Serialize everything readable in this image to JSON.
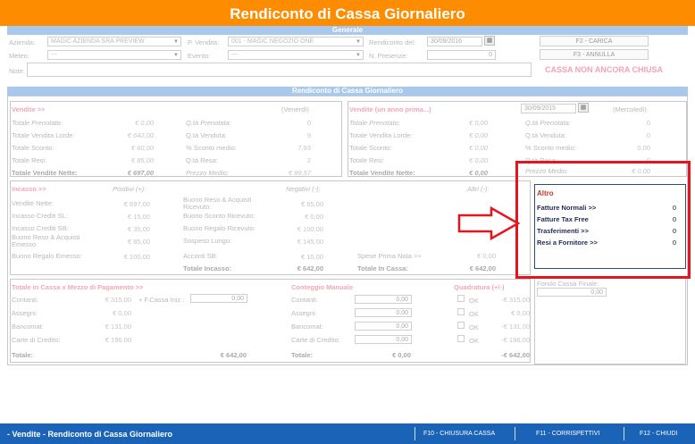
{
  "title": "Rendiconto di Cassa Giornaliero",
  "generale": {
    "header": "Generale",
    "azienda_label": "Azienda:",
    "azienda_value": "MAGIC AZIENDA SRA PREVIEW",
    "pvendita_label": "P. Vendita:",
    "pvendita_value": "001 - MAGIC NEGOZIO ONE",
    "rendiconto_label": "Rendiconto del:",
    "rendiconto_date": "30/09/2016",
    "f2_carica": "F2 - CARICA",
    "meteo_label": "Meteo:",
    "meteo_value": "---",
    "evento_label": "Evento:",
    "evento_value": "---",
    "npresenze_label": "N. Presenze:",
    "npresenze_value": "0",
    "f3_annulla": "F3 - ANNULLA",
    "note_label": "Note:",
    "status": "CASSA NON ANCORA CHIUSA"
  },
  "rendiconto": {
    "header": "Rendiconto di Cassa Giornaliero",
    "vendite": {
      "title": "Vendite >>",
      "day": "(Venerdì)",
      "rows": [
        {
          "label": "Totale Prenotato:",
          "value": "€ 0,00",
          "label2": "Q.tà Prenotata:",
          "value2": "0"
        },
        {
          "label": "Totale Vendita Lorde:",
          "value": "€ 642,00",
          "label2": "Q.tà Venduta:",
          "value2": "9"
        },
        {
          "label": "Totale Sconto:",
          "value": "€ 60,00",
          "label2": "% Sconto medio:",
          "value2": "7,93"
        },
        {
          "label": "Totale Resi:",
          "value": "€ 85,00",
          "label2": "Q.tà Resa:",
          "value2": "2"
        },
        {
          "label": "Totale Vendite Nette:",
          "value": "€ 697,00",
          "label2": "Prezzo Medio:",
          "value2": "€ 99,57"
        }
      ]
    },
    "vendite_anno": {
      "title": "Vendite (un anno prima...)",
      "date": "30/09/2015",
      "day": "(Mercoledì)",
      "rows": [
        {
          "label": "Totale Prenotato:",
          "value": "€ 0,00",
          "label2": "Q.tà Prenotata:",
          "value2": "0"
        },
        {
          "label": "Totale Vendita Lorde:",
          "value": "€ 0,00",
          "label2": "Q.tà Venduta:",
          "value2": "0"
        },
        {
          "label": "Totale Sconto:",
          "value": "€ 0,00",
          "label2": "% Sconto medio:",
          "value2": "0,00"
        },
        {
          "label": "Totale Resi:",
          "value": "€ 0,00",
          "label2": "Q.tà Resa:",
          "value2": "0"
        },
        {
          "label": "Totale Vendite Nette:",
          "value": "€ 0,00",
          "label2": "Prezzo Medio:",
          "value2": "€ 0,00"
        }
      ]
    },
    "incasso": {
      "title": "Incasso >>",
      "positivi": "Positivi (+):",
      "negativi": "Negativi (-):",
      "altri": "Altri (-):",
      "rows": [
        {
          "label": "Vendite Nette:",
          "value": "€ 697,00",
          "label2": "Buono Reso & Acquisti Ricevuto:",
          "value2": "€ 65,00"
        },
        {
          "label": "Incasso Crediti SL:",
          "value": "€ 15,00",
          "label2": "Buono Sconto Ricevuto:",
          "value2": "€ 0,00"
        },
        {
          "label": "Incasso Crediti SB:",
          "value": "€ 35,00",
          "label2": "Buono Regalo Ricevuto:",
          "value2": "€ 100,00"
        },
        {
          "label": "Buono Reso & Acquisti Emesso:",
          "value": "€ 85,00",
          "label2": "Sospeso Lungo:",
          "value2": "€ 145,00"
        },
        {
          "label": "Buono Regalo Emesso:",
          "value": "€ 100,00",
          "label2": "Acconti SB:",
          "value2": "€ 10,00"
        }
      ],
      "spese_label": "Spese Prima Nota >>",
      "spese_value": "€ 0,00",
      "totale_incasso_label": "Totale Incasso:",
      "totale_incasso_value": "€ 642,00",
      "totale_in_cassa_label": "Totale In Cassa:",
      "totale_in_cassa_value": "€ 642,00"
    },
    "altro": {
      "title": "Altro",
      "items": [
        {
          "label": "Fatture Normali >>",
          "value": "0"
        },
        {
          "label": "Fatture Tax Free",
          "value": "0"
        },
        {
          "label": "Trasferimenti >>",
          "value": "0"
        },
        {
          "label": "Resi a Fornitore >>",
          "value": "0"
        }
      ],
      "prezzo_medio_label": "Prezzo Medio:",
      "prezzo_medio_value": "€ 0,00",
      "fondo_label": "Fondo Cassa Finale:",
      "fondo_value": "0,00"
    },
    "totale_cassa": {
      "title": "Totale in Cassa x Mezzo di Pagamento >>",
      "fcassa_label": "+ F.Cassa Iniz.:",
      "fcassa_value": "0,00",
      "rows": [
        {
          "label": "Contanti:",
          "value": "€ 315,00"
        },
        {
          "label": "Assegni:",
          "value": "€ 0,00"
        },
        {
          "label": "Bancomat:",
          "value": "€ 131,00"
        },
        {
          "label": "Carte di Credito:",
          "value": "€ 196,00"
        }
      ],
      "totale_label": "Totale:",
      "totale_value": "€ 642,00"
    },
    "conteggio": {
      "title": "Conteggio Manuale",
      "rows": [
        {
          "label": "Contanti:",
          "value": "0,00"
        },
        {
          "label": "Assegni:",
          "value": "0,00"
        },
        {
          "label": "Bancomat:",
          "value": "0,00"
        },
        {
          "label": "Carte di Credito:",
          "value": "0,00"
        }
      ],
      "totale_label": "Totale:",
      "totale_value": "€ 0,00"
    },
    "quadratura": {
      "title": "Quadratura (+/-)",
      "ok": "OK",
      "rows": [
        "-€ 315,00",
        "€ 0,00",
        "-€ 131,00",
        "-€ 196,00"
      ],
      "totale_value": "-€ 642,00"
    }
  },
  "footer": {
    "title": "- Vendite - Rendiconto di Cassa Giornaliero",
    "f10": "F10 - CHIUSURA CASSA",
    "f11": "F11 - CORRISPETTIVI",
    "f12": "F12 - CHIUDI"
  },
  "colors": {
    "title_bar": "#fd8c00",
    "section_header": "#a8c8ee",
    "footer": "#1a63b6",
    "highlight": "#e6141e"
  }
}
